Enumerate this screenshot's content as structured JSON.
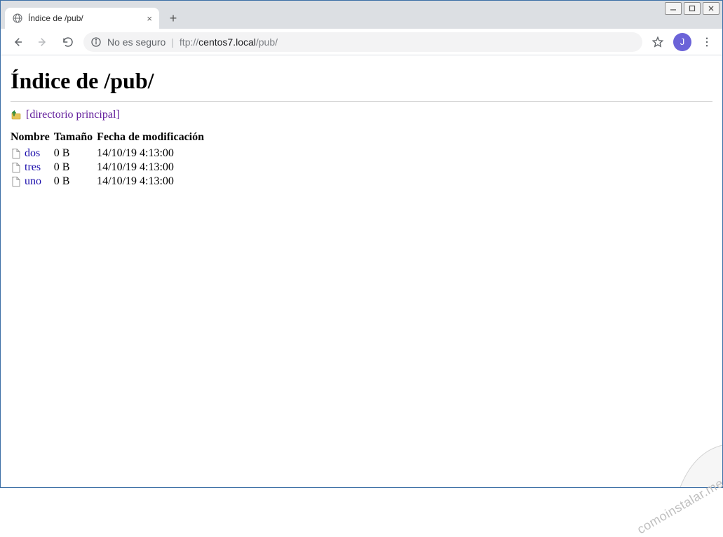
{
  "window": {
    "minimize": "–",
    "maximize": "□",
    "close": "×"
  },
  "browser": {
    "tab_title": "Índice de /pub/",
    "new_tab": "+",
    "tab_close": "×",
    "security_text": "No es seguro",
    "url_scheme": "ftp://",
    "url_host": "centos7.local",
    "url_path": "/pub/",
    "profile_initial": "J",
    "menu": "⋮"
  },
  "page": {
    "heading": "Índice de /pub/",
    "parent_link": "[directorio principal]",
    "columns": {
      "name": "Nombre",
      "size": "Tamaño",
      "date": "Fecha de modificación"
    },
    "files": [
      {
        "name": "dos",
        "size": "0 B",
        "date": "14/10/19 4:13:00"
      },
      {
        "name": "tres",
        "size": "0 B",
        "date": "14/10/19 4:13:00"
      },
      {
        "name": "uno",
        "size": "0 B",
        "date": "14/10/19 4:13:00"
      }
    ]
  },
  "watermark": "comoinstalar.me"
}
